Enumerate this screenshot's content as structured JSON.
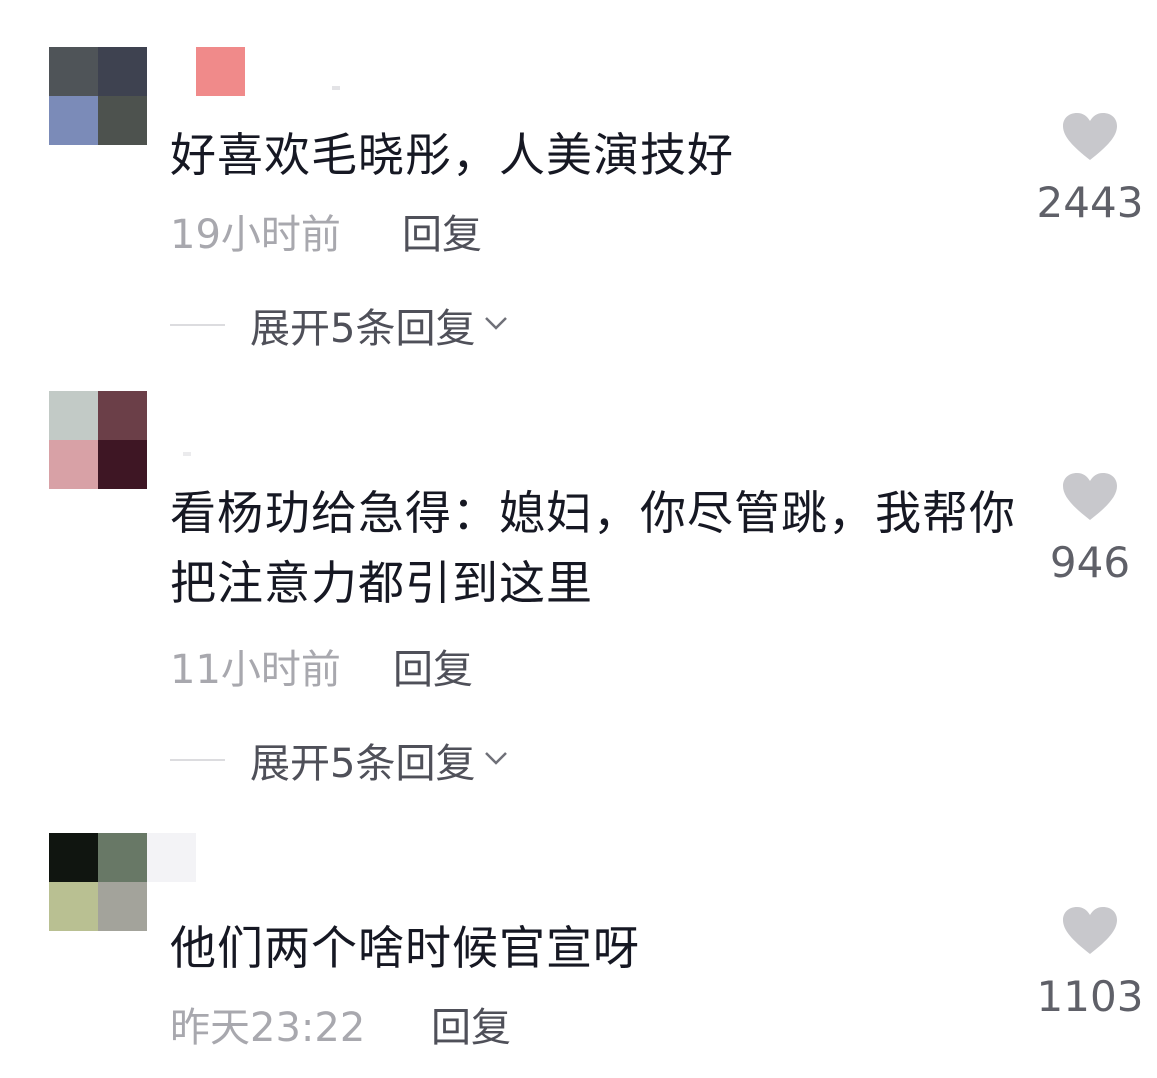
{
  "comments": [
    {
      "text": "好喜欢毛晓彤，人美演技好",
      "time": "19小时前",
      "reply_label": "回复",
      "expand_label": "展开5条回复",
      "likes": "2443",
      "avatar_colors": [
        "#4f5458",
        "#3e4250",
        "#7b8bb8",
        "#4d524e"
      ]
    },
    {
      "text": "看杨玏给急得：媳妇，你尽管跳，我帮你把注意力都引到这里",
      "time": "11小时前",
      "reply_label": "回复",
      "expand_label": "展开5条回复",
      "likes": "946",
      "avatar_colors": [
        "#c2cac6",
        "#6b3f48",
        "#d8a1a6",
        "#3e1624"
      ]
    },
    {
      "text": "他们两个啥时候官宣呀",
      "time": "昨天23:22",
      "reply_label": "回复",
      "likes": "1103",
      "avatar_colors": [
        "#101510",
        "#687866",
        "#b9c092",
        "#a3a39b"
      ]
    }
  ],
  "icons": {
    "like": "heart-icon",
    "expand": "chevron-down-icon"
  },
  "colors": {
    "text": "#161823",
    "meta": "#a8a8ae",
    "heart": "#c8c8cc"
  }
}
